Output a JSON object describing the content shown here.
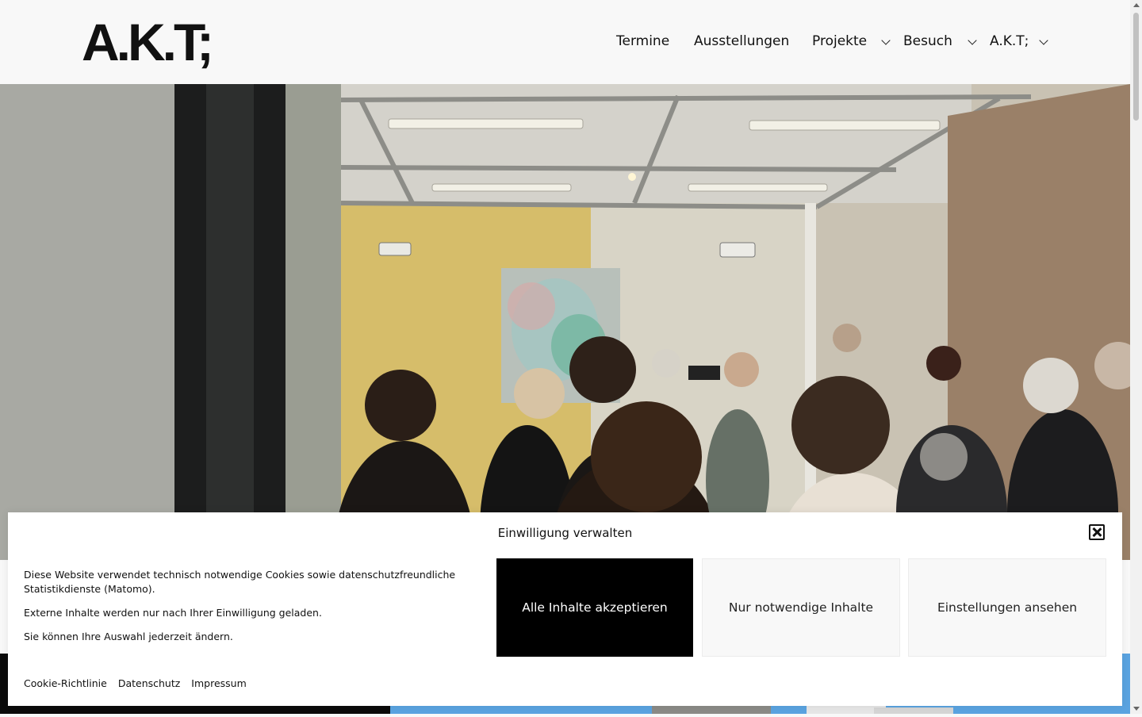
{
  "header": {
    "logo": "A.K.T;",
    "nav": [
      {
        "label": "Termine",
        "has_submenu": false
      },
      {
        "label": "Ausstellungen",
        "has_submenu": false
      },
      {
        "label": "Projekte",
        "has_submenu": true
      },
      {
        "label": "Besuch",
        "has_submenu": true
      },
      {
        "label": "A.K.T;",
        "has_submenu": true
      }
    ]
  },
  "hero": {
    "image": "gallery-opening-crowd-photo"
  },
  "cookie": {
    "title": "Einwilligung verwalten",
    "text": [
      "Diese Website verwendet technisch notwendige Cookies sowie datenschutzfreundliche Statistikdienste (Matomo).",
      "Externe Inhalte werden nur nach Ihrer Einwilligung geladen.",
      "Sie können Ihre Auswahl jederzeit ändern."
    ],
    "buttons": {
      "accept": "Alle Inhalte akzeptieren",
      "necessary": "Nur notwendige Inhalte",
      "settings": "Einstellungen ansehen"
    },
    "links": {
      "cookie_policy": "Cookie-Richtlinie",
      "privacy": "Datenschutz",
      "imprint": "Impressum"
    }
  },
  "colors": {
    "background": "#f8f8f8",
    "accept_button": "#000000",
    "teaser_blue": "#5aa3e0"
  }
}
